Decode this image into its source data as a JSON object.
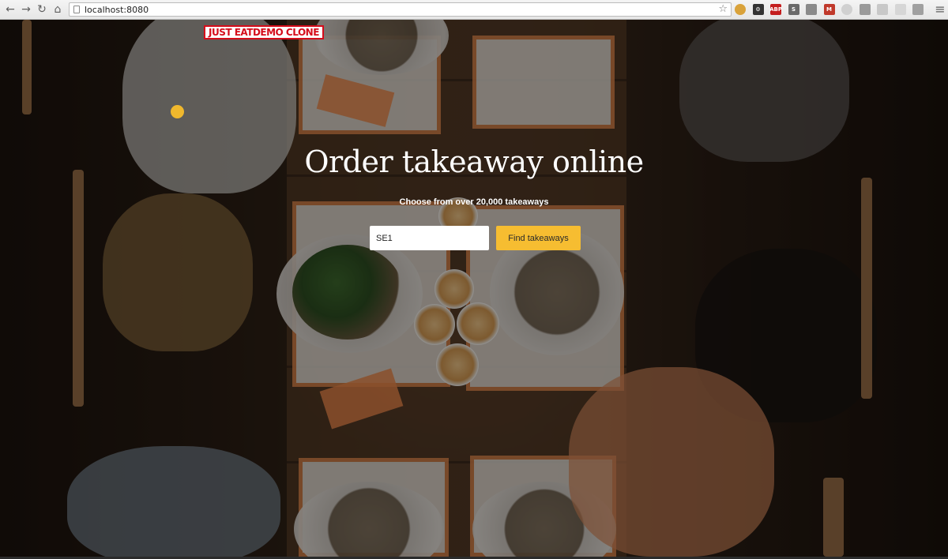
{
  "browser": {
    "url": "localhost:8080",
    "nav": {
      "back": "←",
      "forward": "→",
      "reload": "↻",
      "home": "⌂"
    },
    "star": "☆",
    "menu": "≡",
    "extensions": [
      {
        "name": "cookie",
        "label": "",
        "color": "#d9a23a"
      },
      {
        "name": "gear",
        "label": "⚙",
        "color": "#333333"
      },
      {
        "name": "adblock",
        "label": "ABP",
        "color": "#c41e1e"
      },
      {
        "name": "s-ext",
        "label": "S",
        "color": "#6a6a6a"
      },
      {
        "name": "lock-ext",
        "label": "",
        "color": "#8a8a8a"
      },
      {
        "name": "m-ext",
        "label": "M",
        "color": "#c0392b"
      },
      {
        "name": "grey-ext-1",
        "label": "",
        "color": "#d0d0d0"
      },
      {
        "name": "grey-ext-2",
        "label": "",
        "color": "#9a9a9a"
      },
      {
        "name": "grey-ext-3",
        "label": "",
        "color": "#c8c8c8"
      },
      {
        "name": "grey-ext-4",
        "label": "",
        "color": "#d6d6d6"
      },
      {
        "name": "camera",
        "label": "",
        "color": "#a0a0a0"
      }
    ]
  },
  "header": {
    "logo_text": "JUST EATDEMO CLONE",
    "logo_color": "#d50c1a"
  },
  "hero": {
    "title": "Order takeaway online",
    "subtitle": "Choose from over 20,000 takeaways",
    "search_value": "SE1",
    "button_label": "Find takeaways",
    "button_color": "#f6bd31"
  }
}
